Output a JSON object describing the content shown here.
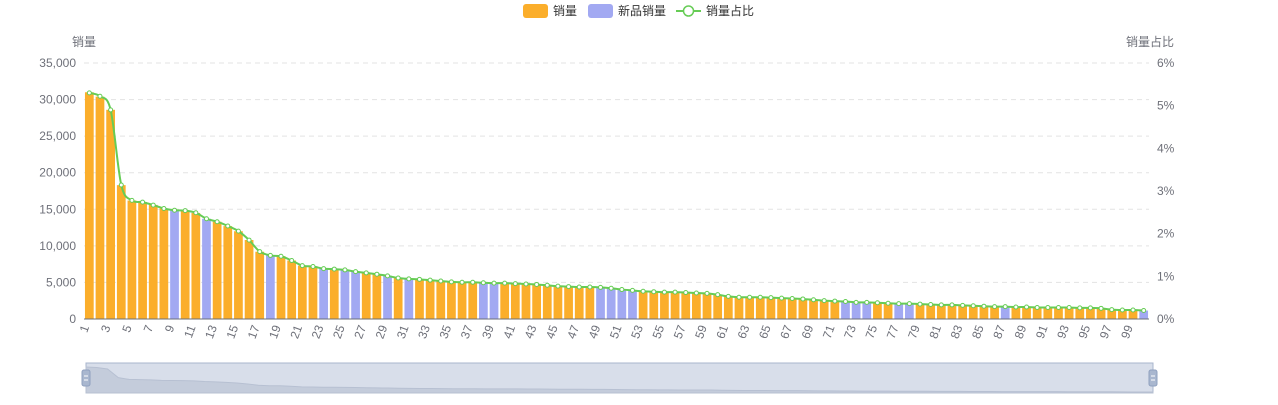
{
  "colors": {
    "primary_bar": "#FBAE2B",
    "new_bar": "#A2A9F2",
    "line": "#66CC55",
    "grid": "#E3E3E3",
    "axis_text": "#6E7079",
    "zoom_fill": "#D8DEEA",
    "zoom_border": "#A8B5CC",
    "handle": "#A9B7CF"
  },
  "legend": {
    "items": [
      {
        "label": "销量",
        "kind": "bar",
        "color": "#FBAE2B"
      },
      {
        "label": "新品销量",
        "kind": "bar",
        "color": "#A2A9F2"
      },
      {
        "label": "销量占比",
        "kind": "line",
        "color": "#66CC55"
      }
    ]
  },
  "chart_data": {
    "type": "bar",
    "title": "",
    "xlabel": "",
    "ylabel": "销量",
    "y2label": "销量占比",
    "ylim": [
      0,
      35000
    ],
    "y2lim": [
      0,
      6
    ],
    "y_ticks": [
      "0",
      "5,000",
      "10,000",
      "15,000",
      "20,000",
      "25,000",
      "30,000",
      "35,000"
    ],
    "y2_ticks": [
      "0%",
      "1%",
      "2%",
      "3%",
      "4%",
      "5%",
      "6%"
    ],
    "grid": true,
    "legend_position": "top-center",
    "categories": [
      "1",
      "2",
      "3",
      "4",
      "5",
      "6",
      "7",
      "8",
      "9",
      "10",
      "11",
      "12",
      "13",
      "14",
      "15",
      "16",
      "17",
      "18",
      "19",
      "20",
      "21",
      "22",
      "23",
      "24",
      "25",
      "26",
      "27",
      "28",
      "29",
      "30",
      "31",
      "32",
      "33",
      "34",
      "35",
      "36",
      "37",
      "38",
      "39",
      "40",
      "41",
      "42",
      "43",
      "44",
      "45",
      "46",
      "47",
      "48",
      "49",
      "50",
      "51",
      "52",
      "53",
      "54",
      "55",
      "56",
      "57",
      "58",
      "59",
      "60",
      "61",
      "62",
      "63",
      "64",
      "65",
      "66",
      "67",
      "68",
      "69",
      "70",
      "71",
      "72",
      "73",
      "74",
      "75",
      "76",
      "77",
      "78",
      "79",
      "80",
      "81",
      "82",
      "83",
      "84",
      "85",
      "86",
      "87",
      "88",
      "89",
      "90",
      "91",
      "92",
      "93",
      "94",
      "95",
      "96",
      "97",
      "98",
      "99",
      "100"
    ],
    "x_tick_labels": [
      "1",
      "3",
      "5",
      "7",
      "9",
      "11",
      "13",
      "15",
      "17",
      "19",
      "21",
      "23",
      "25",
      "27",
      "29",
      "31",
      "33",
      "35",
      "37",
      "39",
      "41",
      "43",
      "45",
      "47",
      "49",
      "51",
      "53",
      "55",
      "57",
      "59",
      "61",
      "63",
      "65",
      "67",
      "69",
      "71",
      "73",
      "75",
      "77",
      "79",
      "81",
      "83",
      "85",
      "87",
      "89",
      "91",
      "93",
      "95",
      "97",
      "99"
    ],
    "values": [
      31000,
      30400,
      28600,
      18300,
      16200,
      16000,
      15600,
      15100,
      14900,
      14800,
      14500,
      13700,
      13300,
      12700,
      12000,
      10800,
      9200,
      8700,
      8600,
      8000,
      7300,
      7200,
      6900,
      6800,
      6700,
      6500,
      6300,
      6100,
      5900,
      5600,
      5500,
      5400,
      5300,
      5200,
      5100,
      5000,
      5000,
      4950,
      4900,
      4900,
      4850,
      4800,
      4700,
      4600,
      4500,
      4450,
      4400,
      4350,
      4300,
      4200,
      4000,
      3900,
      3800,
      3750,
      3700,
      3650,
      3600,
      3550,
      3500,
      3300,
      3100,
      3000,
      3000,
      2950,
      2900,
      2850,
      2800,
      2750,
      2600,
      2500,
      2450,
      2400,
      2300,
      2250,
      2200,
      2150,
      2100,
      2100,
      2050,
      2000,
      1950,
      1900,
      1850,
      1800,
      1750,
      1700,
      1700,
      1650,
      1650,
      1600,
      1600,
      1550,
      1550,
      1500,
      1500,
      1450,
      1300,
      1250,
      1200,
      1150
    ],
    "new_product_indices": [
      9,
      12,
      18,
      23,
      25,
      26,
      29,
      31,
      38,
      39,
      49,
      50,
      51,
      52,
      72,
      73,
      74,
      77,
      78,
      87,
      100
    ],
    "series": [
      {
        "name": "销量",
        "kind": "bar"
      },
      {
        "name": "新品销量",
        "kind": "bar"
      },
      {
        "name": "销量占比",
        "kind": "line",
        "axis": "right",
        "values": [
          5.3,
          5.22,
          4.9,
          3.14,
          2.78,
          2.74,
          2.67,
          2.59,
          2.55,
          2.54,
          2.49,
          2.35,
          2.28,
          2.18,
          2.06,
          1.85,
          1.58,
          1.49,
          1.47,
          1.37,
          1.25,
          1.23,
          1.18,
          1.17,
          1.15,
          1.11,
          1.08,
          1.05,
          1.01,
          0.96,
          0.94,
          0.93,
          0.91,
          0.89,
          0.87,
          0.86,
          0.86,
          0.85,
          0.84,
          0.84,
          0.83,
          0.82,
          0.81,
          0.79,
          0.77,
          0.76,
          0.75,
          0.75,
          0.74,
          0.72,
          0.69,
          0.67,
          0.65,
          0.64,
          0.63,
          0.63,
          0.62,
          0.61,
          0.6,
          0.57,
          0.53,
          0.51,
          0.51,
          0.51,
          0.5,
          0.49,
          0.48,
          0.47,
          0.45,
          0.43,
          0.42,
          0.41,
          0.39,
          0.39,
          0.38,
          0.37,
          0.36,
          0.36,
          0.35,
          0.34,
          0.33,
          0.33,
          0.32,
          0.31,
          0.3,
          0.29,
          0.29,
          0.28,
          0.28,
          0.27,
          0.27,
          0.27,
          0.27,
          0.26,
          0.26,
          0.25,
          0.22,
          0.21,
          0.21,
          0.2
        ]
      }
    ]
  }
}
